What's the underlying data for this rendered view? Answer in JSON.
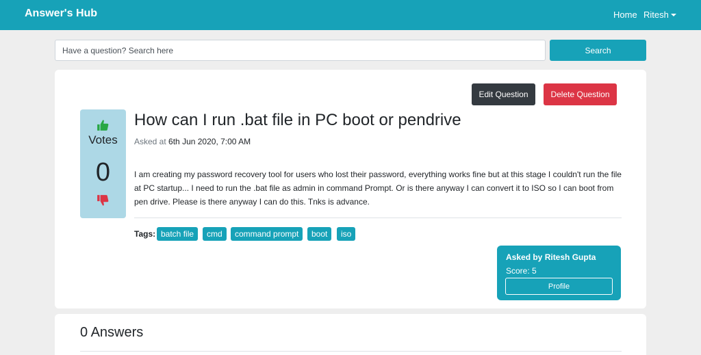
{
  "navbar": {
    "brand": "Answer's Hub",
    "links": {
      "home": "Home",
      "user": "Ritesh"
    }
  },
  "search": {
    "placeholder": "Have a question? Search here",
    "button_label": "Search"
  },
  "question": {
    "actions": {
      "edit_label": "Edit Question",
      "delete_label": "Delete Question"
    },
    "votes": {
      "label": "Votes",
      "count": "0"
    },
    "title": "How can I run .bat file in PC boot or pendrive",
    "asked_at_label": "Asked at",
    "asked_at_value": "6th Jun 2020, 7:00 AM",
    "body": "I am creating my password recovery tool for users who lost their password, everything works fine but at this stage I couldn't run the file at PC startup... I need to run the .bat file as admin in command Prompt. Or is there anyway I can convert it to ISO so I can boot from pen drive. Please is there anyway I can do this. Tnks is advance.",
    "tags_label": "Tags:",
    "tags": [
      "batch file",
      "cmd",
      "command prompt",
      "boot",
      "iso"
    ],
    "author": {
      "asked_by": "Asked by Ritesh Gupta",
      "score": "Score: 5",
      "profile_label": "Profile"
    }
  },
  "answers": {
    "title": "0 Answers"
  },
  "colors": {
    "primary": "#17a2b8",
    "dark": "#343a40",
    "danger": "#dc3545",
    "votes_bg": "#add8e6",
    "upvote": "#28a745",
    "downvote": "#dc3545"
  },
  "icons": {
    "upvote": "thumbs-up-icon",
    "downvote": "thumbs-down-icon",
    "dropdown": "caret-down-icon"
  }
}
